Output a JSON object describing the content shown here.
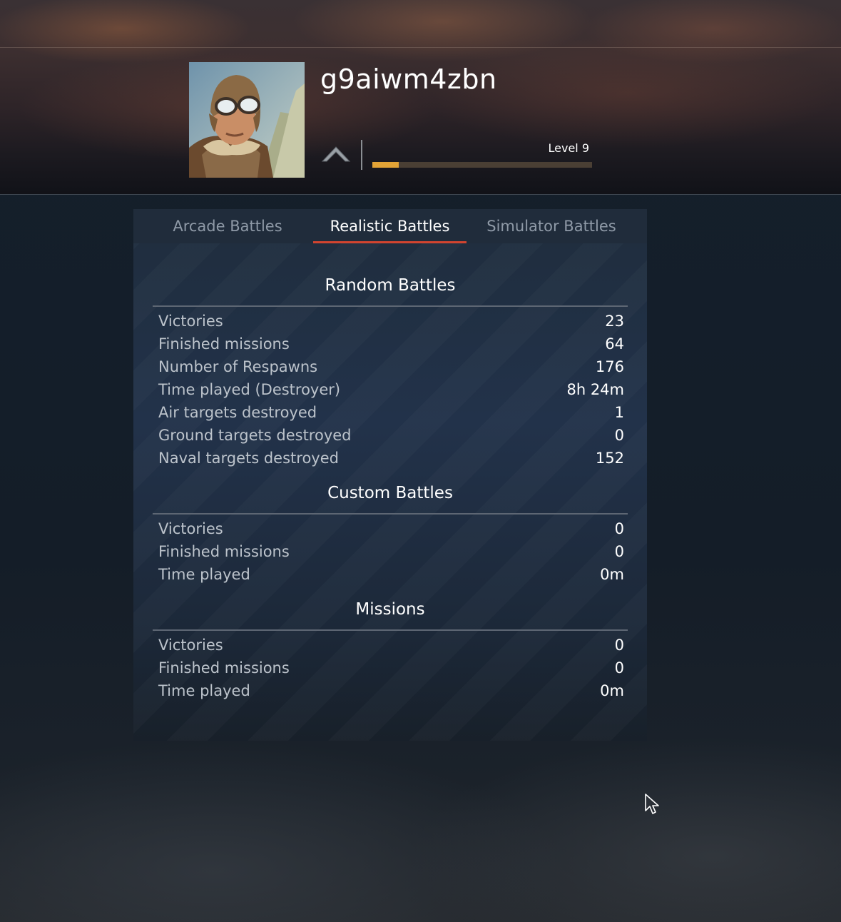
{
  "profile": {
    "nickname": "g9aiwm4zbn",
    "level_label": "Level 9",
    "level_progress": 0.12
  },
  "tabs": [
    {
      "label": "Arcade Battles",
      "active": false
    },
    {
      "label": "Realistic Battles",
      "active": true
    },
    {
      "label": "Simulator Battles",
      "active": false
    }
  ],
  "sections": {
    "random": {
      "title": "Random Battles",
      "rows": [
        {
          "label": "Victories",
          "value": "23"
        },
        {
          "label": "Finished missions",
          "value": "64"
        },
        {
          "label": "Number of Respawns",
          "value": "176"
        },
        {
          "label": "Time played (Destroyer)",
          "value": "8h 24m"
        },
        {
          "label": "Air targets destroyed",
          "value": "1"
        },
        {
          "label": "Ground targets destroyed",
          "value": "0"
        },
        {
          "label": "Naval targets destroyed",
          "value": "152"
        }
      ]
    },
    "custom": {
      "title": "Custom Battles",
      "rows": [
        {
          "label": "Victories",
          "value": "0"
        },
        {
          "label": "Finished missions",
          "value": "0"
        },
        {
          "label": "Time played",
          "value": "0m"
        }
      ]
    },
    "missions": {
      "title": "Missions",
      "rows": [
        {
          "label": "Victories",
          "value": "0"
        },
        {
          "label": "Finished missions",
          "value": "0"
        },
        {
          "label": "Time played",
          "value": "0m"
        }
      ]
    }
  },
  "colors": {
    "accent_tab_underline": "#d2442f",
    "level_bar_fill": "#e2a336",
    "level_bar_track": "#4a3f34"
  },
  "icons": {
    "rank": "chevron-up-icon",
    "avatar": "pilot-portrait",
    "cursor": "mouse-pointer-icon"
  }
}
